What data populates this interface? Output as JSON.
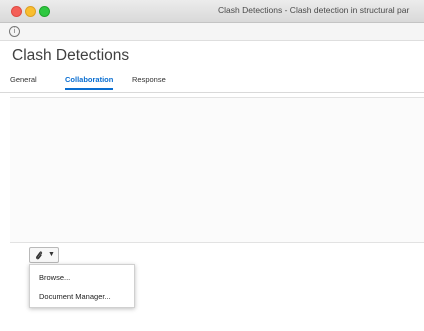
{
  "window": {
    "title": "Clash Detections - Clash detection in structural par"
  },
  "infobar": {
    "icon": "info-icon",
    "icon_glyph": "i"
  },
  "page": {
    "title": "Clash Detections"
  },
  "tabs": [
    {
      "label": "General",
      "selected": false
    },
    {
      "label": "Collaboration",
      "selected": true
    },
    {
      "label": "Response",
      "selected": false
    }
  ],
  "attach_button": {
    "icon": "paperclip-icon",
    "dropdown_icon": "caret-down-icon",
    "caret_glyph": "▼"
  },
  "dropdown_menu": {
    "items": [
      {
        "label": "Browse..."
      },
      {
        "label": "Document Manager..."
      }
    ]
  },
  "colors": {
    "accent": "#0a6ed1",
    "traffic_close": "#f45f58",
    "traffic_min": "#f9be2f",
    "traffic_max": "#2ec840"
  }
}
